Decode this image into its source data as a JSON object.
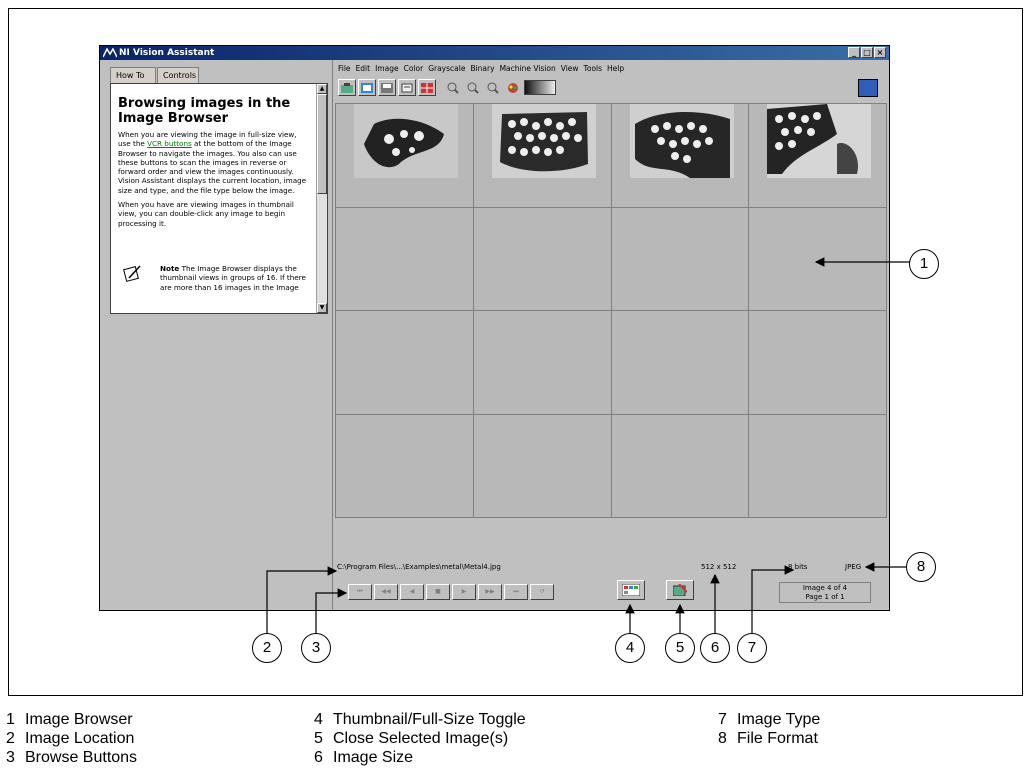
{
  "window": {
    "title": "NI Vision Assistant",
    "controls": [
      "_",
      "□",
      "×"
    ]
  },
  "left_panel": {
    "tabs": [
      "How To",
      "Controls"
    ],
    "help": {
      "title": "Browsing images in the Image Browser",
      "p1_before_link": "When you are viewing the image in full-size view, use the ",
      "p1_link": "VCR buttons",
      "p1_after_link": " at the bottom of the Image Browser to navigate the images. You also can use these buttons to scan the images in reverse or forward order and view the images continuously. Vision Assistant displays the current location, image size and type, and the file type below the image.",
      "p2": "When you have are viewing images in thumbnail view, you can double-click any image to begin processing it.",
      "note_label": "Note",
      "note_text": "The Image Browser displays the thumbnail views in groups of 16. If there are more than 16 images in the Image"
    }
  },
  "menubar": [
    "File",
    "Edit",
    "Image",
    "Color",
    "Grayscale",
    "Binary",
    "Machine Vision",
    "View",
    "Tools",
    "Help"
  ],
  "toolbar": {
    "icons": [
      "acquire-image-icon",
      "browse-images-icon",
      "save-image-icon",
      "script-icon",
      "table-icon",
      "zoom-in-icon",
      "zoom-out-icon",
      "zoom-1to1-icon",
      "palette-icon",
      "lookup-table-icon"
    ]
  },
  "status": {
    "path": "C:\\Program Files\\...\\Examples\\metal\\Metal4.jpg",
    "size": "512 x 512",
    "type": "8 bits",
    "format": "JPEG",
    "image_index": "Image  4 of 4",
    "page_index": "Page  1 of 1"
  },
  "nav_buttons": [
    "⏮",
    "◀◀",
    "◀",
    "■",
    "▶",
    "▶▶",
    "⏭",
    "↺"
  ],
  "callouts": [
    "1",
    "2",
    "3",
    "4",
    "5",
    "6",
    "7",
    "8"
  ],
  "legend": [
    {
      "num": "1",
      "label": "Image Browser"
    },
    {
      "num": "2",
      "label": "Image Location"
    },
    {
      "num": "3",
      "label": "Browse Buttons"
    },
    {
      "num": "4",
      "label": "Thumbnail/Full-Size Toggle"
    },
    {
      "num": "5",
      "label": "Close Selected Image(s)"
    },
    {
      "num": "6",
      "label": "Image Size"
    },
    {
      "num": "7",
      "label": "Image Type"
    },
    {
      "num": "8",
      "label": "File Format"
    }
  ]
}
